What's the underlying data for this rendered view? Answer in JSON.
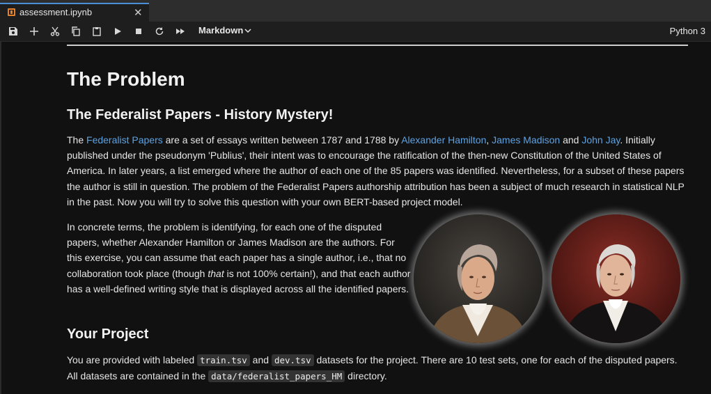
{
  "tab": {
    "title": "assessment.ipynb",
    "close_glyph": "✕"
  },
  "toolbar": {
    "buttons": [
      "save-icon",
      "add-cell-icon",
      "cut-icon",
      "copy-icon",
      "paste-icon",
      "run-icon",
      "stop-icon",
      "restart-icon",
      "run-all-icon"
    ],
    "cell_type": "Markdown",
    "kernel": "Python 3"
  },
  "doc": {
    "title": "The Problem",
    "subtitle": "The Federalist Papers - History Mystery!",
    "p1": {
      "t1": "The ",
      "link_papers": "Federalist Papers",
      "t2": " are a set of essays written between 1787 and 1788 by ",
      "link_hamilton": "Alexander Hamilton",
      "t3": ", ",
      "link_madison": "James Madison",
      "t4": " and ",
      "link_jay": "John Jay",
      "t5": ". Initially published under the pseudonym 'Publius', their intent was to encourage the ratification of the then-new Constitution of the United States of America. In later years, a list emerged where the author of each one of the 85 papers was identified. Nevertheless, for a subset of these papers the author is still in question. The problem of the Federalist Papers authorship attribution has been a subject of much research in statistical NLP in the past. Now you will try to solve this question with your own BERT-based project model."
    },
    "p2": {
      "t1": "In concrete terms, the problem is identifying, for each one of the disputed papers, whether Alexander Hamilton or James Madison are the authors. For this exercise, you can assume that each paper has a single author, i.e., that no collaboration took place (though ",
      "em": "that",
      "t2": " is not 100% certain!), and that each author has a well-defined writing style that is displayed across all the identified papers."
    },
    "project_heading": "Your Project",
    "p3": {
      "t1": "You are provided with labeled ",
      "code1": "train.tsv",
      "t2": " and ",
      "code2": "dev.tsv",
      "t3": " datasets for the project. There are 10 test sets, one for each of the disputed papers. All datasets are contained in the ",
      "code3": "data/federalist_papers_HM",
      "t4": " directory."
    }
  },
  "colors": {
    "link": "#5fa2e2",
    "tab_accent": "#4a8fd8",
    "notebook_icon": "#e8812a"
  }
}
